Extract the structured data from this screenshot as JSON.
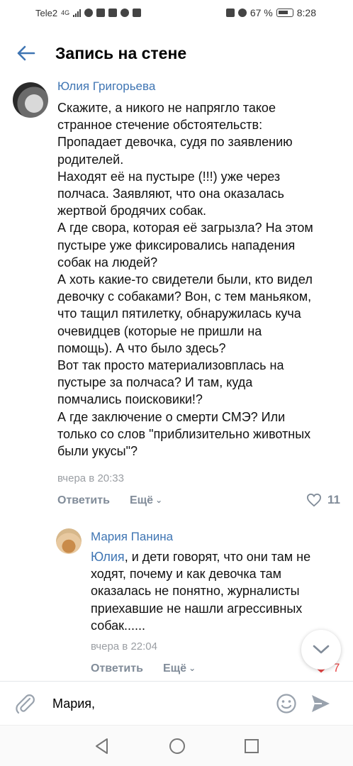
{
  "status_bar": {
    "carrier": "Tele2",
    "network": "4G",
    "battery_percent": "67 %",
    "time": "8:28"
  },
  "header": {
    "title": "Запись на стене",
    "back_icon": "arrow-left-icon",
    "accent_color": "#3f75b3"
  },
  "comments": [
    {
      "author": "Юлия Григорьева",
      "text": "Скажите, а никого не напрягло такое\nстранное стечение обстоятельств:\nПропадает девочка, судя по заявлению\nродителей.\nНаходят её на пустыре (!!!) уже через\nполчаса. Заявляют, что она оказалась\nжертвой бродячих собак.\nА где свора, которая её загрызла? На этом\nпустыре уже фиксировались нападения\nсобак на людей?\nА хоть какие-то свидетели были, кто видел\nдевочку с собаками? Вон, с тем маньяком,\nчто тащил пятилетку, обнаружилась куча\nочевидцев (которые не пришли на\nпомощь). А что было здесь?\nВот так просто материализовплась на\nпустыре за полчаса? И там, куда\nпомчались поисковики!?\nА где заключение о смерти СМЭ? Или\nтолько со слов \"приблизительно животных\nбыли укусы\"?",
      "time": "вчера в 20:33",
      "reply_label": "Ответить",
      "more_label": "Ещё",
      "likes": "11"
    },
    {
      "author": "Мария Панина",
      "mention": "Юлия",
      "text": ", и дети говорят, что они там не\nходят, почему и как девочка там\nоказалась не понятно, журналисты\nприехавшие не нашли агрессивных\nсобак......",
      "time": "вчера в 22:04",
      "reply_label": "Ответить",
      "more_label": "Ещё",
      "likes": "7"
    }
  ],
  "input_bar": {
    "value": "Мария,",
    "attach_icon": "paperclip-icon",
    "emoji_icon": "smiley-icon",
    "send_icon": "send-icon"
  },
  "nav_bar": {
    "back_icon": "triangle-back-icon",
    "home_icon": "circle-home-icon",
    "recent_icon": "square-recent-icon"
  }
}
